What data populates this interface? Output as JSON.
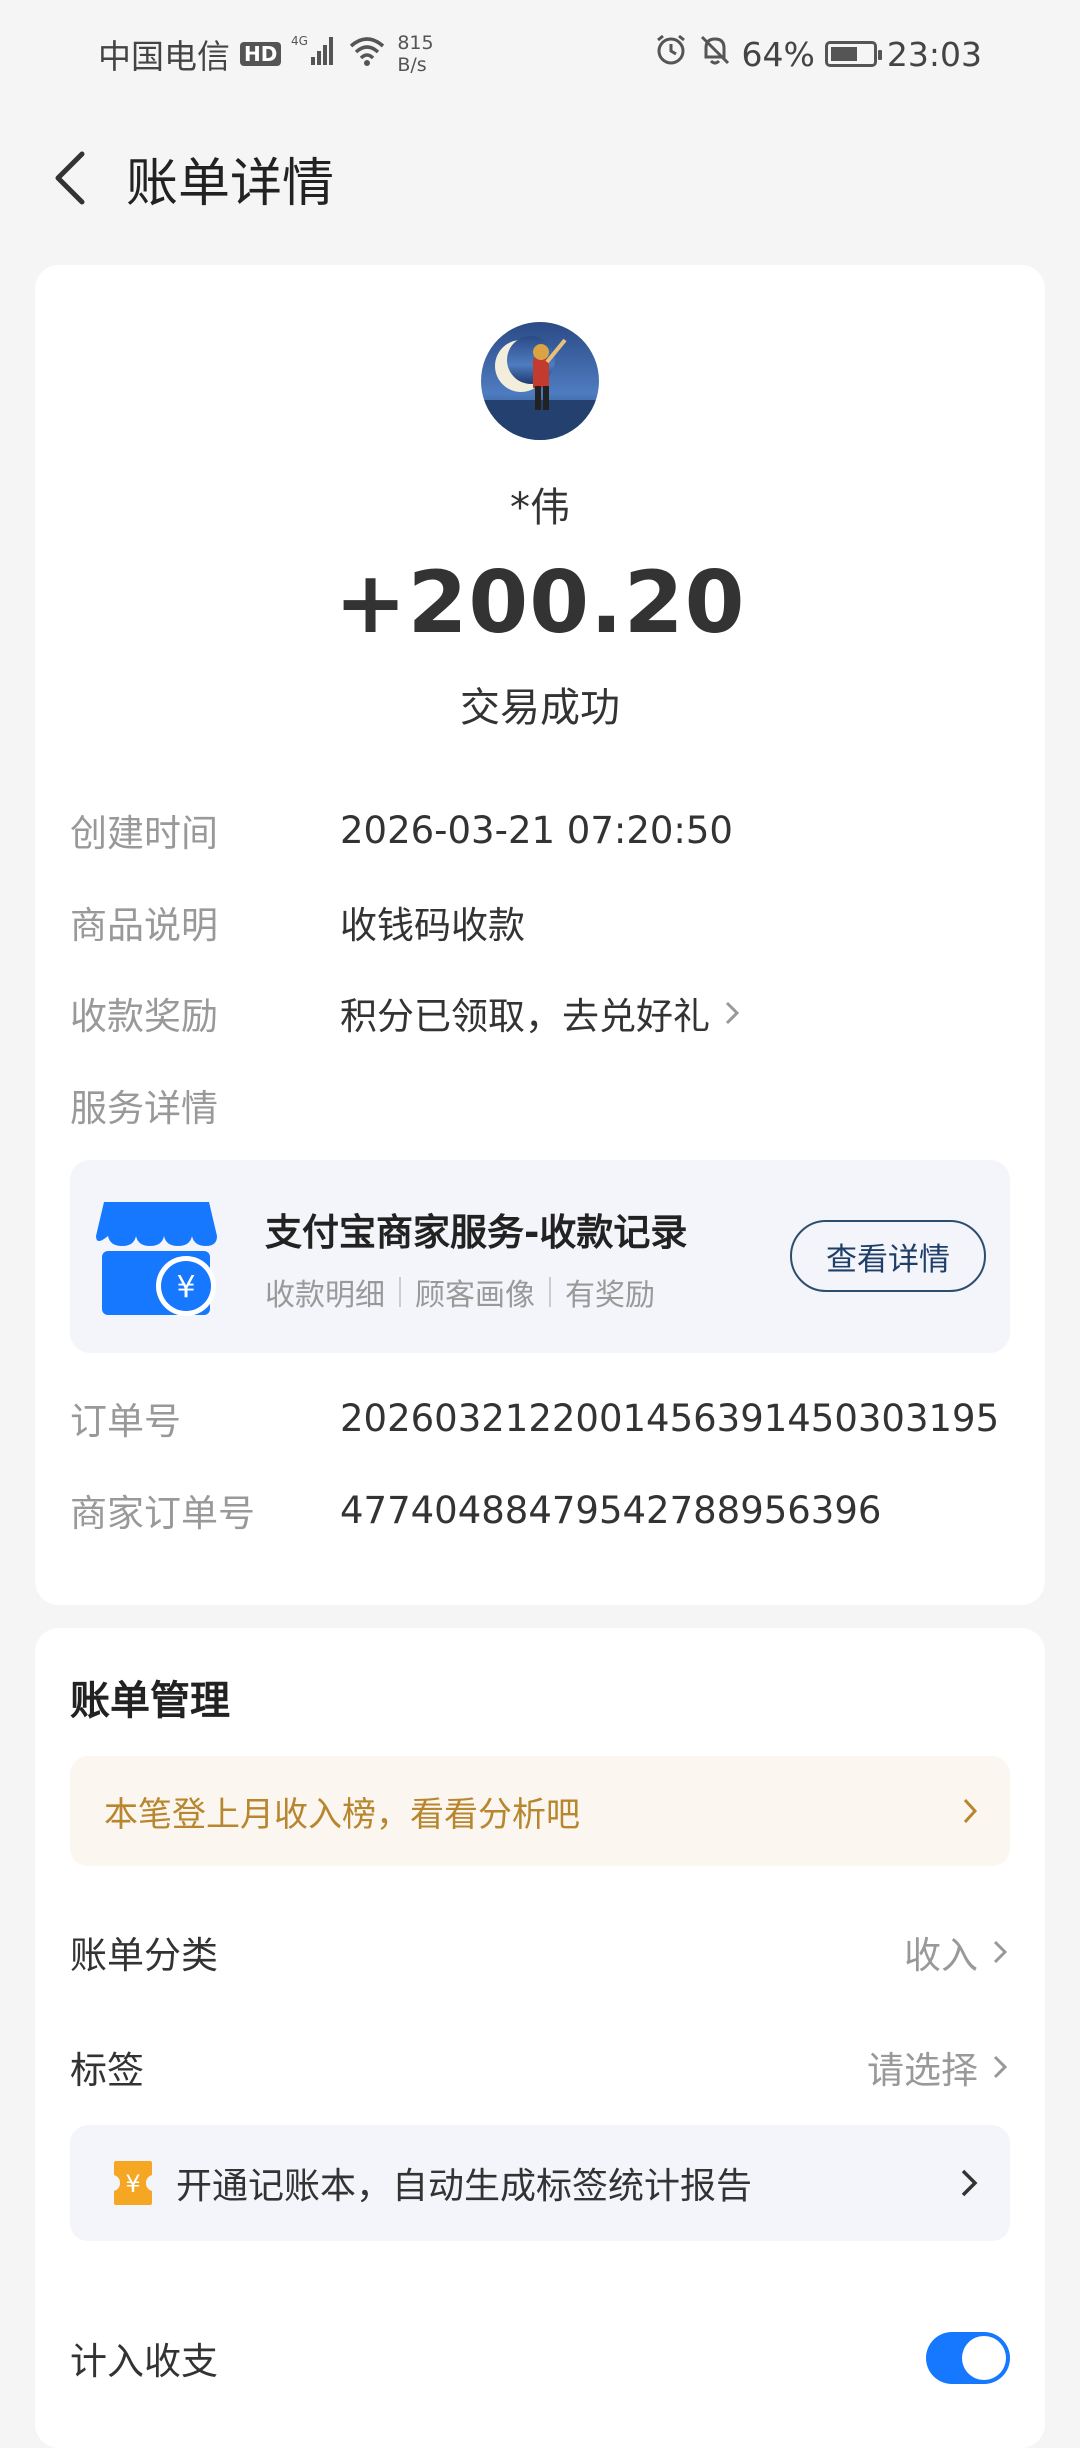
{
  "status_bar": {
    "carrier": "中国电信",
    "hd": "HD",
    "network": "4G",
    "speed_value": "815",
    "speed_unit": "B/s",
    "battery": "64%",
    "battery_level": 0.64,
    "time": "23:03"
  },
  "header": {
    "title": "账单详情"
  },
  "transaction": {
    "payer_name": "*伟",
    "amount": "+200.20",
    "status": "交易成功"
  },
  "details": {
    "created_time_label": "创建时间",
    "created_time_value": "2026-03-21 07:20:50",
    "product_label": "商品说明",
    "product_value": "收钱码收款",
    "reward_label": "收款奖励",
    "reward_value": "积分已领取，去兑好礼",
    "service_label": "服务详情",
    "order_label": "订单号",
    "order_value": "2026032122001456391450303195",
    "merchant_order_label": "商家订单号",
    "merchant_order_value": "4774048847954278895639​6"
  },
  "service_card": {
    "title": "支付宝商家服务-收款记录",
    "sub_items": [
      "收款明细",
      "顾客画像",
      "有奖励"
    ],
    "button": "查看详情"
  },
  "bill_management": {
    "title": "账单管理",
    "notice": "本笔登上月收入榜，看看分析吧",
    "category_label": "账单分类",
    "category_value": "收入",
    "tag_label": "标签",
    "tag_value": "请选择",
    "ledger_text": "开通记账本，自动生成标签统计报告",
    "include_label": "计入收支",
    "include_enabled": true
  },
  "colors": {
    "accent_blue": "#1677ff",
    "notice_text": "#b8862e",
    "notice_bg": "#fbf6ef"
  }
}
